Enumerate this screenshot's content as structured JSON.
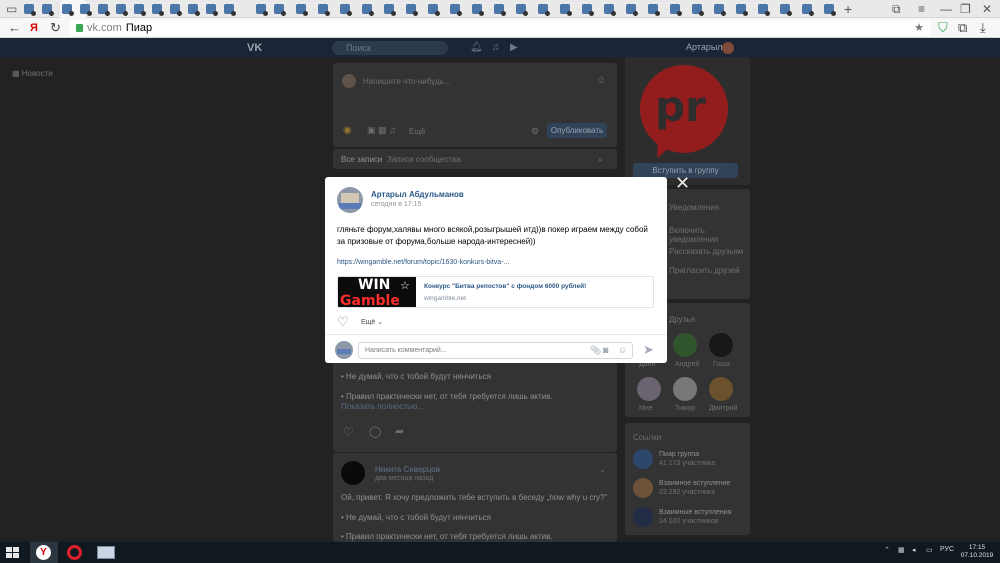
{
  "browser": {
    "domain": "vk.com",
    "page_title": "Пиар",
    "new_tab": "+",
    "yandex_label": "Я",
    "tab_icon": "vk-tab-icon"
  },
  "vk": {
    "header": {
      "logo": "VK",
      "search_placeholder": "Поиск",
      "user_name": "Артарыл"
    },
    "left_menu_item": "Новости",
    "composer": {
      "placeholder": "Напишите что-нибудь...",
      "visibility": "Ещё",
      "publish": "Опубликовать"
    },
    "feed_tabs": [
      "Все записи",
      "Записи сообщества"
    ],
    "group_button": "Вступить в группу",
    "right_menu": [
      "Уведомления",
      "Включить уведомления",
      "Рассказать друзьям",
      "Пригласить друзей"
    ],
    "friends_title": "Друзья",
    "friends": [
      "Даня",
      "Андрей",
      "Гоша",
      "Мне",
      "Тимур",
      "Дмитрий"
    ],
    "links_title": "Ссылки",
    "groups": [
      {
        "name": "Пиар группа",
        "members": "41 173 участника"
      },
      {
        "name": "Взаимное вступление",
        "members": "23 292 участника"
      },
      {
        "name": "Взаимные вступления",
        "members": "14 020 участников"
      }
    ],
    "bg_post": {
      "line1": "• Не думай, что с тобой будут нянчиться",
      "line2": "• Правил практически нет, от тебя требуется лишь актив.",
      "show_full": "Показать полностью..."
    },
    "bg_post2": {
      "author": "Никита Северцов",
      "date": "два месяца назад",
      "text": "Ой, привет. Я хочу предложить тебе вступить в беседу „how why u cry?“",
      "line1": "• Не думай, что с тобой будут нянчиться",
      "line2": "• Правил практически нет, от тебя требуется лишь актив."
    }
  },
  "modal": {
    "author": "Артарыл Абдульманов",
    "date": "сегодня в 17:15",
    "text": "гляньте форум,халявы много всякой,розыгрышей итд))в покер играем между собой за призовые от форума,больше народа-интересней))",
    "link": "https://wingamble.net/forum/topic/1630-konkurs-bitva-...",
    "snippet": {
      "img_word1": "WIN",
      "img_word2": "Gamble",
      "title": "Конкурс \"Битва репостов\" с фондом 6000 рублей!",
      "domain": "wingamble.net"
    },
    "more": "Ещё",
    "comment_placeholder": "Написать комментарий..."
  },
  "taskbar": {
    "lang": "РУС",
    "time": "17:15",
    "date": "07.10.2019"
  },
  "colors": {
    "vk_blue": "#2a5885",
    "vk_header": "#223148",
    "logo_red": "#bd2426",
    "overlay_page": "#2c2c2c"
  }
}
